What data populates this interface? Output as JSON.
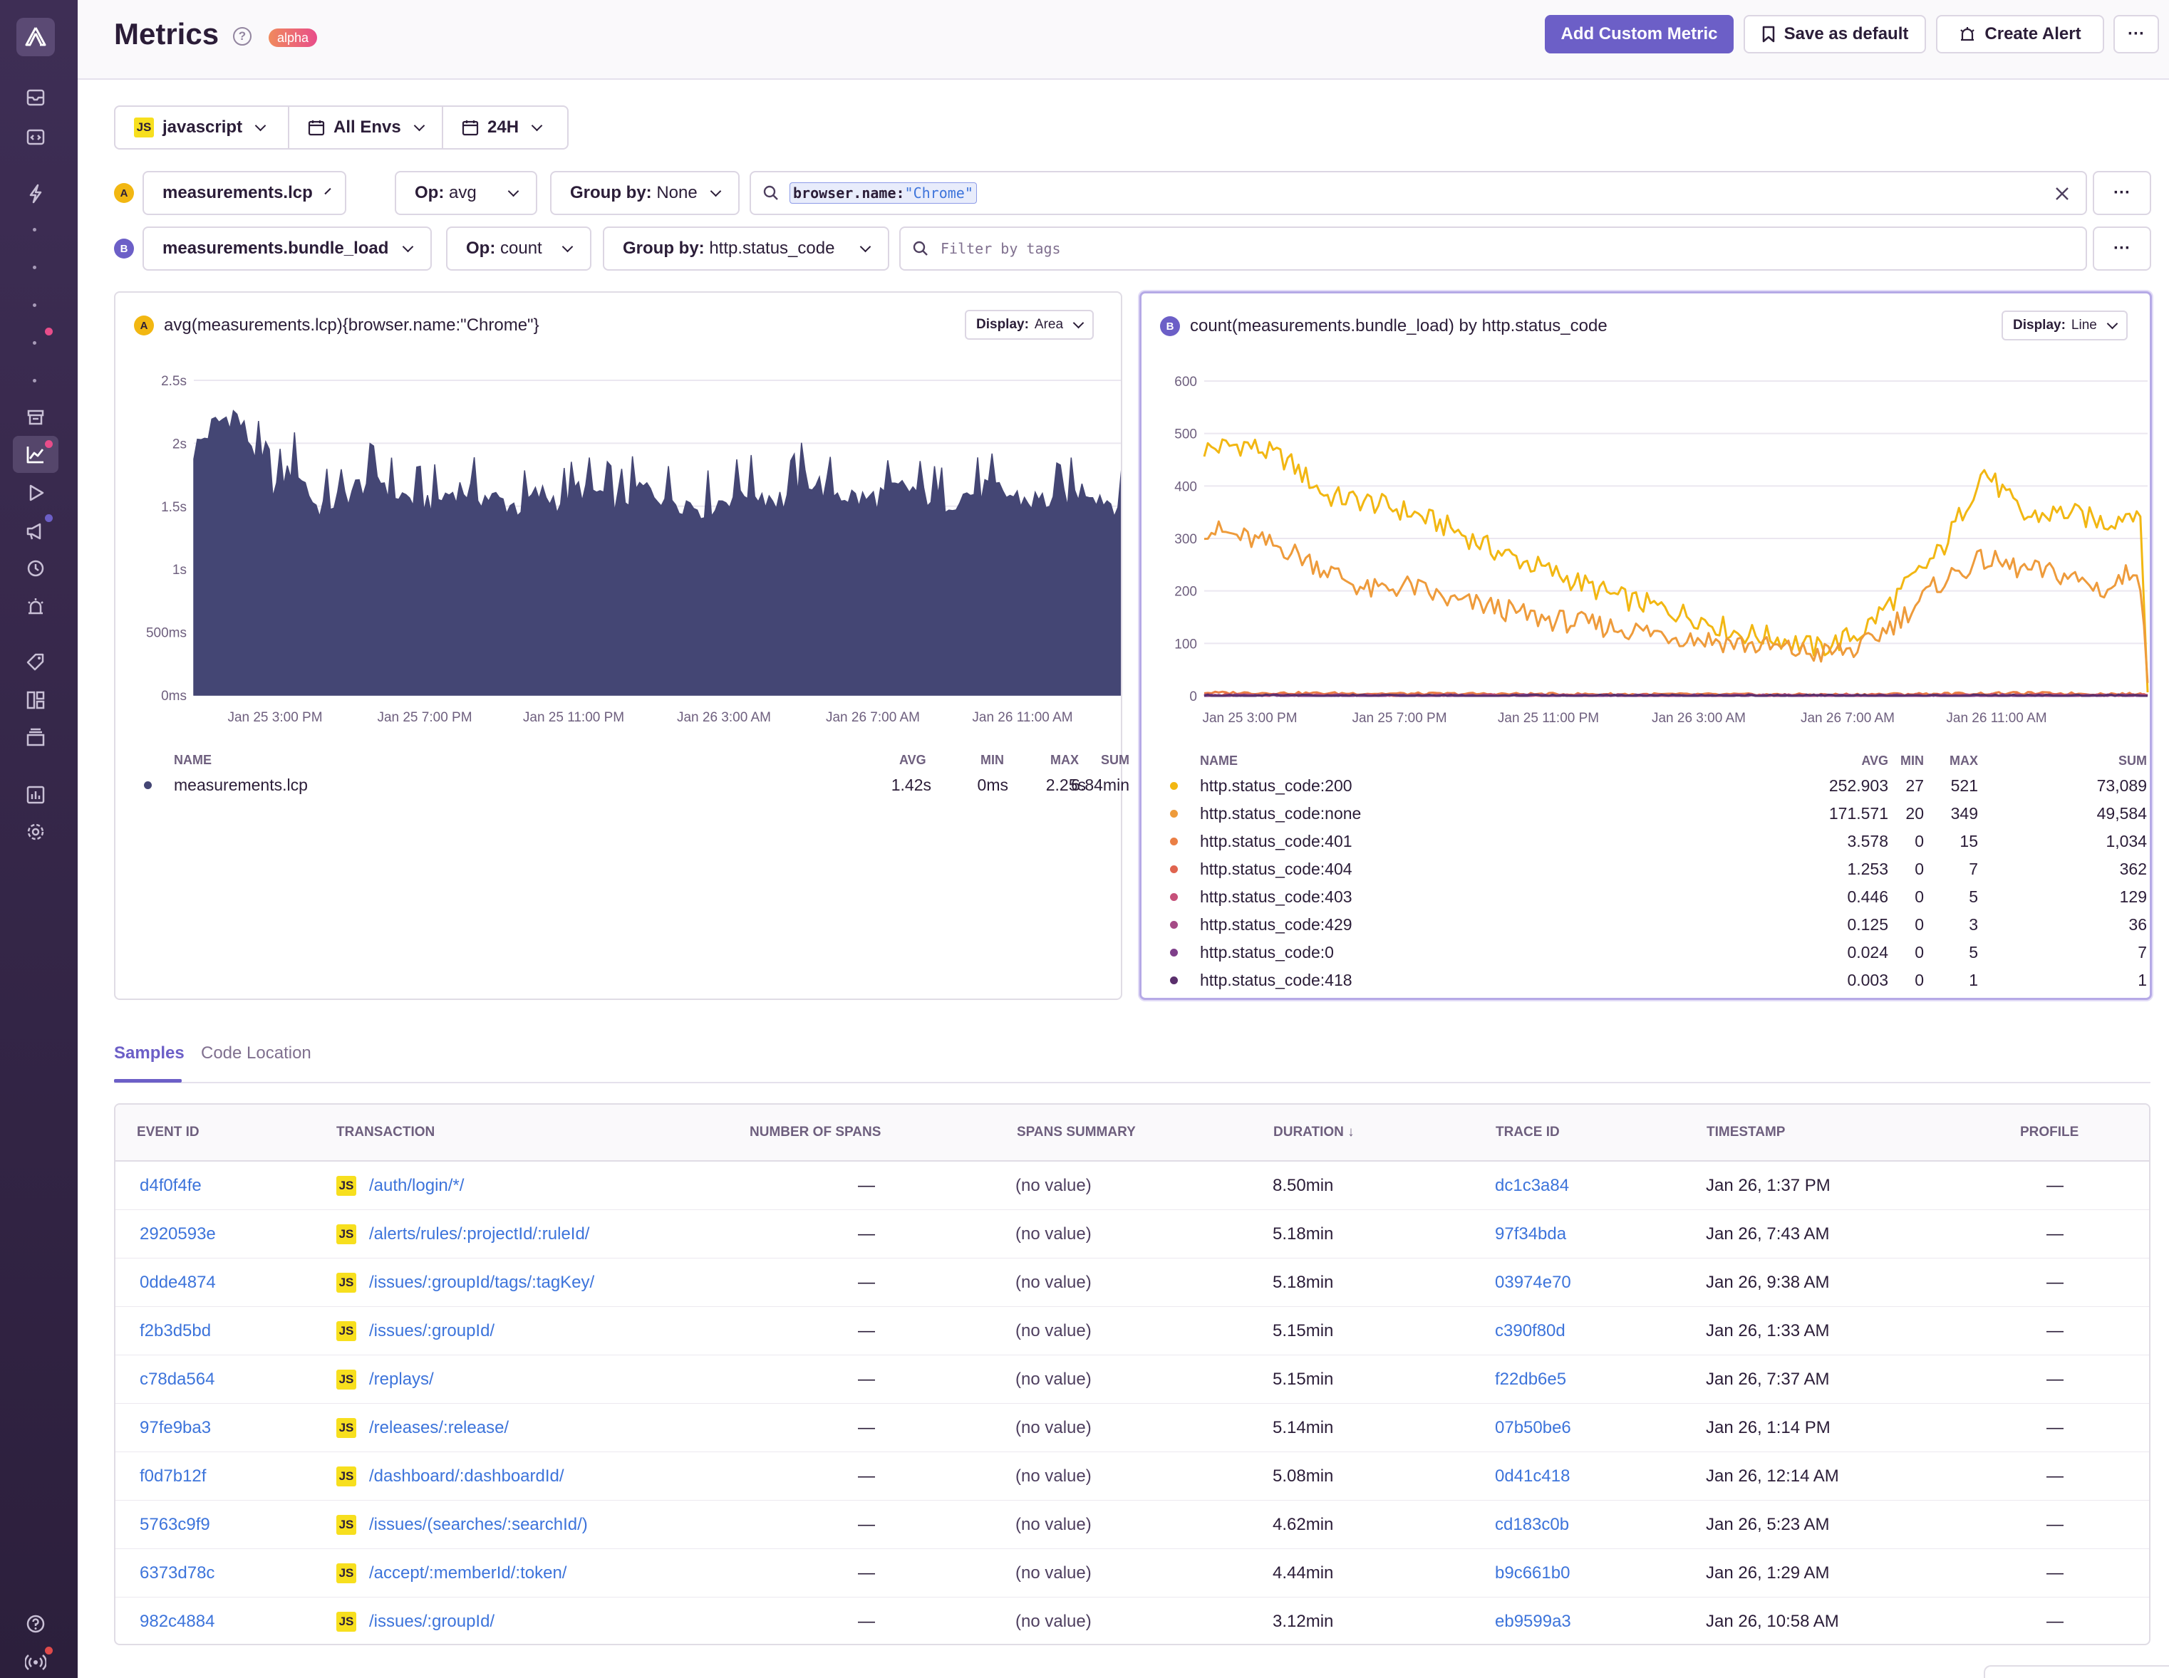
{
  "header": {
    "title": "Metrics",
    "badge": "alpha",
    "add_custom_metric": "Add Custom Metric",
    "save_as_default": "Save as default",
    "create_alert": "Create Alert",
    "more": "···"
  },
  "filters": {
    "project": "javascript",
    "project_badge": "JS",
    "environment": "All Envs",
    "period": "24H"
  },
  "queries": [
    {
      "label": "A",
      "metric": "measurements.lcp",
      "op_label": "Op:",
      "op": "avg",
      "group_label": "Group by:",
      "group": "None",
      "search_key": "browser.name:",
      "search_value": "\"Chrome\"",
      "more": "···"
    },
    {
      "label": "B",
      "metric": "measurements.bundle_load",
      "op_label": "Op:",
      "op": "count",
      "group_label": "Group by:",
      "group": "http.status_code",
      "search_placeholder": "Filter by tags",
      "more": "···"
    }
  ],
  "panels": [
    {
      "label": "A",
      "title": "avg(measurements.lcp){browser.name:\"Chrome\"}",
      "display_label": "Display:",
      "display": "Area",
      "legend_headers": [
        "NAME",
        "AVG",
        "MIN",
        "MAX",
        "SUM"
      ],
      "legend": [
        {
          "name": "measurements.lcp",
          "avg": "1.42s",
          "min": "0ms",
          "max": "2.25s",
          "sum": "6.84min",
          "color": "#444674"
        }
      ]
    },
    {
      "label": "B",
      "title": "count(measurements.bundle_load) by http.status_code",
      "display_label": "Display:",
      "display": "Line",
      "legend_headers": [
        "NAME",
        "AVG",
        "MIN",
        "MAX",
        "SUM"
      ],
      "legend": [
        {
          "name": "http.status_code:200",
          "avg": "252.903",
          "min": "27",
          "max": "521",
          "sum": "73,089",
          "color": "#f2b712"
        },
        {
          "name": "http.status_code:none",
          "avg": "171.571",
          "min": "20",
          "max": "349",
          "sum": "49,584",
          "color": "#ee9b3b"
        },
        {
          "name": "http.status_code:401",
          "avg": "3.578",
          "min": "0",
          "max": "15",
          "sum": "1,034",
          "color": "#ea7f45"
        },
        {
          "name": "http.status_code:404",
          "avg": "1.253",
          "min": "0",
          "max": "7",
          "sum": "362",
          "color": "#e0644f"
        },
        {
          "name": "http.status_code:403",
          "avg": "0.446",
          "min": "0",
          "max": "5",
          "sum": "129",
          "color": "#c6507a"
        },
        {
          "name": "http.status_code:429",
          "avg": "0.125",
          "min": "0",
          "max": "3",
          "sum": "36",
          "color": "#a54a86"
        },
        {
          "name": "http.status_code:0",
          "avg": "0.024",
          "min": "0",
          "max": "5",
          "sum": "7",
          "color": "#7f3f8a"
        },
        {
          "name": "http.status_code:418",
          "avg": "0.003",
          "min": "0",
          "max": "1",
          "sum": "1",
          "color": "#5a2f6c"
        }
      ]
    }
  ],
  "chart_data": [
    {
      "type": "area",
      "title": "avg(measurements.lcp){browser.name:\"Chrome\"}",
      "y_ticks": [
        "0ms",
        "500ms",
        "1s",
        "1.5s",
        "2s",
        "2.5s"
      ],
      "ylim": [
        0,
        2.5
      ],
      "y_unit": "s",
      "x_ticks": [
        "Jan 25 3:00 PM",
        "Jan 25 7:00 PM",
        "Jan 25 11:00 PM",
        "Jan 26 3:00 AM",
        "Jan 26 7:00 AM",
        "Jan 26 11:00 AM"
      ],
      "x_range_hours": [
        0,
        23
      ],
      "grid": true,
      "series": [
        {
          "name": "measurements.lcp",
          "color": "#444674",
          "x_hours": [
            0,
            0.5,
            1,
            1.5,
            2,
            2.5,
            3,
            3.5,
            4,
            4.5,
            5,
            5.5,
            6,
            6.5,
            7,
            7.5,
            8,
            8.5,
            9,
            9.5,
            10,
            10.5,
            11,
            11.5,
            12,
            12.5,
            13,
            13.5,
            14,
            14.5,
            15,
            15.5,
            16,
            16.5,
            17,
            17.5,
            18,
            18.5,
            19,
            19.5,
            20,
            20.5,
            21,
            21.5,
            22,
            22.5,
            23
          ],
          "y": [
            1.9,
            2.1,
            2.2,
            1.9,
            1.6,
            1.8,
            1.45,
            1.5,
            1.6,
            1.7,
            1.55,
            1.5,
            1.5,
            1.6,
            1.55,
            1.5,
            1.45,
            1.55,
            1.5,
            1.6,
            1.55,
            1.5,
            1.6,
            1.55,
            1.5,
            1.45,
            1.5,
            1.6,
            1.55,
            1.5,
            1.7,
            1.6,
            1.55,
            1.5,
            1.55,
            1.6,
            1.55,
            1.5,
            1.55,
            1.6,
            1.55,
            1.5,
            1.5,
            1.55,
            1.6,
            1.5,
            1.45
          ]
        }
      ]
    },
    {
      "type": "line",
      "title": "count(measurements.bundle_load) by http.status_code",
      "y_ticks": [
        "0",
        "100",
        "200",
        "300",
        "400",
        "500",
        "600"
      ],
      "ylim": [
        0,
        600
      ],
      "x_ticks": [
        "Jan 25 3:00 PM",
        "Jan 25 7:00 PM",
        "Jan 25 11:00 PM",
        "Jan 26 3:00 AM",
        "Jan 26 7:00 AM",
        "Jan 26 11:00 AM"
      ],
      "x_range_hours": [
        0,
        23
      ],
      "grid": true,
      "series": [
        {
          "name": "http.status_code:200",
          "color": "#f2b712",
          "x_hours": [
            0,
            1,
            2,
            3,
            4,
            5,
            6,
            7,
            8,
            9,
            10,
            11,
            12,
            13,
            14,
            15,
            16,
            17,
            18,
            19,
            20,
            21,
            22,
            22.8,
            23
          ],
          "y": [
            470,
            480,
            450,
            380,
            370,
            350,
            320,
            280,
            250,
            220,
            190,
            170,
            150,
            120,
            110,
            90,
            120,
            200,
            280,
            430,
            340,
            350,
            330,
            360,
            20
          ]
        },
        {
          "name": "http.status_code:none",
          "color": "#ee9b3b",
          "x_hours": [
            0,
            1,
            2,
            3,
            4,
            5,
            6,
            7,
            8,
            9,
            10,
            11,
            12,
            13,
            14,
            15,
            16,
            17,
            18,
            19,
            20,
            21,
            22,
            22.8,
            23
          ],
          "y": [
            320,
            300,
            280,
            240,
            200,
            210,
            180,
            170,
            150,
            140,
            130,
            120,
            110,
            100,
            90,
            80,
            90,
            150,
            220,
            260,
            240,
            230,
            200,
            250,
            10
          ]
        },
        {
          "name": "http.status_code:401",
          "color": "#ea7f45",
          "x_hours": [
            0,
            5,
            10,
            15,
            20,
            23
          ],
          "y": [
            6,
            4,
            3,
            2,
            5,
            3
          ]
        },
        {
          "name": "http.status_code:404",
          "color": "#e0644f",
          "x_hours": [
            0,
            5,
            10,
            15,
            20,
            23
          ],
          "y": [
            2,
            1,
            1,
            1,
            2,
            1
          ]
        },
        {
          "name": "http.status_code:403",
          "color": "#c6507a",
          "x_hours": [
            0,
            23
          ],
          "y": [
            0.5,
            0.4
          ]
        },
        {
          "name": "http.status_code:429",
          "color": "#a54a86",
          "x_hours": [
            0,
            23
          ],
          "y": [
            0.1,
            0.1
          ]
        },
        {
          "name": "http.status_code:0",
          "color": "#7f3f8a",
          "x_hours": [
            0,
            23
          ],
          "y": [
            0,
            0
          ]
        },
        {
          "name": "http.status_code:418",
          "color": "#5a2f6c",
          "x_hours": [
            0,
            23
          ],
          "y": [
            0,
            0
          ]
        }
      ]
    }
  ],
  "tabs": [
    {
      "label": "Samples",
      "active": true
    },
    {
      "label": "Code Location",
      "active": false
    }
  ],
  "table": {
    "headers": [
      "EVENT ID",
      "TRANSACTION",
      "NUMBER OF SPANS",
      "SPANS SUMMARY",
      "DURATION",
      "TRACE ID",
      "TIMESTAMP",
      "PROFILE"
    ],
    "sort_icon": "↓",
    "rows": [
      {
        "event_id": "d4f0f4fe",
        "transaction": "/auth/login/*/",
        "spans": "—",
        "summary": "(no value)",
        "duration": "8.50min",
        "trace_id": "dc1c3a84",
        "timestamp": "Jan 26, 1:37 PM",
        "profile": "—"
      },
      {
        "event_id": "2920593e",
        "transaction": "/alerts/rules/:projectId/:ruleId/",
        "spans": "—",
        "summary": "(no value)",
        "duration": "5.18min",
        "trace_id": "97f34bda",
        "timestamp": "Jan 26, 7:43 AM",
        "profile": "—"
      },
      {
        "event_id": "0dde4874",
        "transaction": "/issues/:groupId/tags/:tagKey/",
        "spans": "—",
        "summary": "(no value)",
        "duration": "5.18min",
        "trace_id": "03974e70",
        "timestamp": "Jan 26, 9:38 AM",
        "profile": "—"
      },
      {
        "event_id": "f2b3d5bd",
        "transaction": "/issues/:groupId/",
        "spans": "—",
        "summary": "(no value)",
        "duration": "5.15min",
        "trace_id": "c390f80d",
        "timestamp": "Jan 26, 1:33 AM",
        "profile": "—"
      },
      {
        "event_id": "c78da564",
        "transaction": "/replays/",
        "spans": "—",
        "summary": "(no value)",
        "duration": "5.15min",
        "trace_id": "f22db6e5",
        "timestamp": "Jan 26, 7:37 AM",
        "profile": "—"
      },
      {
        "event_id": "97fe9ba3",
        "transaction": "/releases/:release/",
        "spans": "—",
        "summary": "(no value)",
        "duration": "5.14min",
        "trace_id": "07b50be6",
        "timestamp": "Jan 26, 1:14 PM",
        "profile": "—"
      },
      {
        "event_id": "f0d7b12f",
        "transaction": "/dashboard/:dashboardId/",
        "spans": "—",
        "summary": "(no value)",
        "duration": "5.08min",
        "trace_id": "0d41c418",
        "timestamp": "Jan 26, 12:14 AM",
        "profile": "—"
      },
      {
        "event_id": "5763c9f9",
        "transaction": "/issues/(searches/:searchId/)",
        "spans": "—",
        "summary": "(no value)",
        "duration": "4.62min",
        "trace_id": "cd183c0b",
        "timestamp": "Jan 26, 5:23 AM",
        "profile": "—"
      },
      {
        "event_id": "6373d78c",
        "transaction": "/accept/:memberId/:token/",
        "spans": "—",
        "summary": "(no value)",
        "duration": "4.44min",
        "trace_id": "b9c661b0",
        "timestamp": "Jan 26, 1:29 AM",
        "profile": "—"
      },
      {
        "event_id": "982c4884",
        "transaction": "/issues/:groupId/",
        "spans": "—",
        "summary": "(no value)",
        "duration": "3.12min",
        "trace_id": "eb9599a3",
        "timestamp": "Jan 26, 10:58 AM",
        "profile": "—"
      }
    ]
  }
}
